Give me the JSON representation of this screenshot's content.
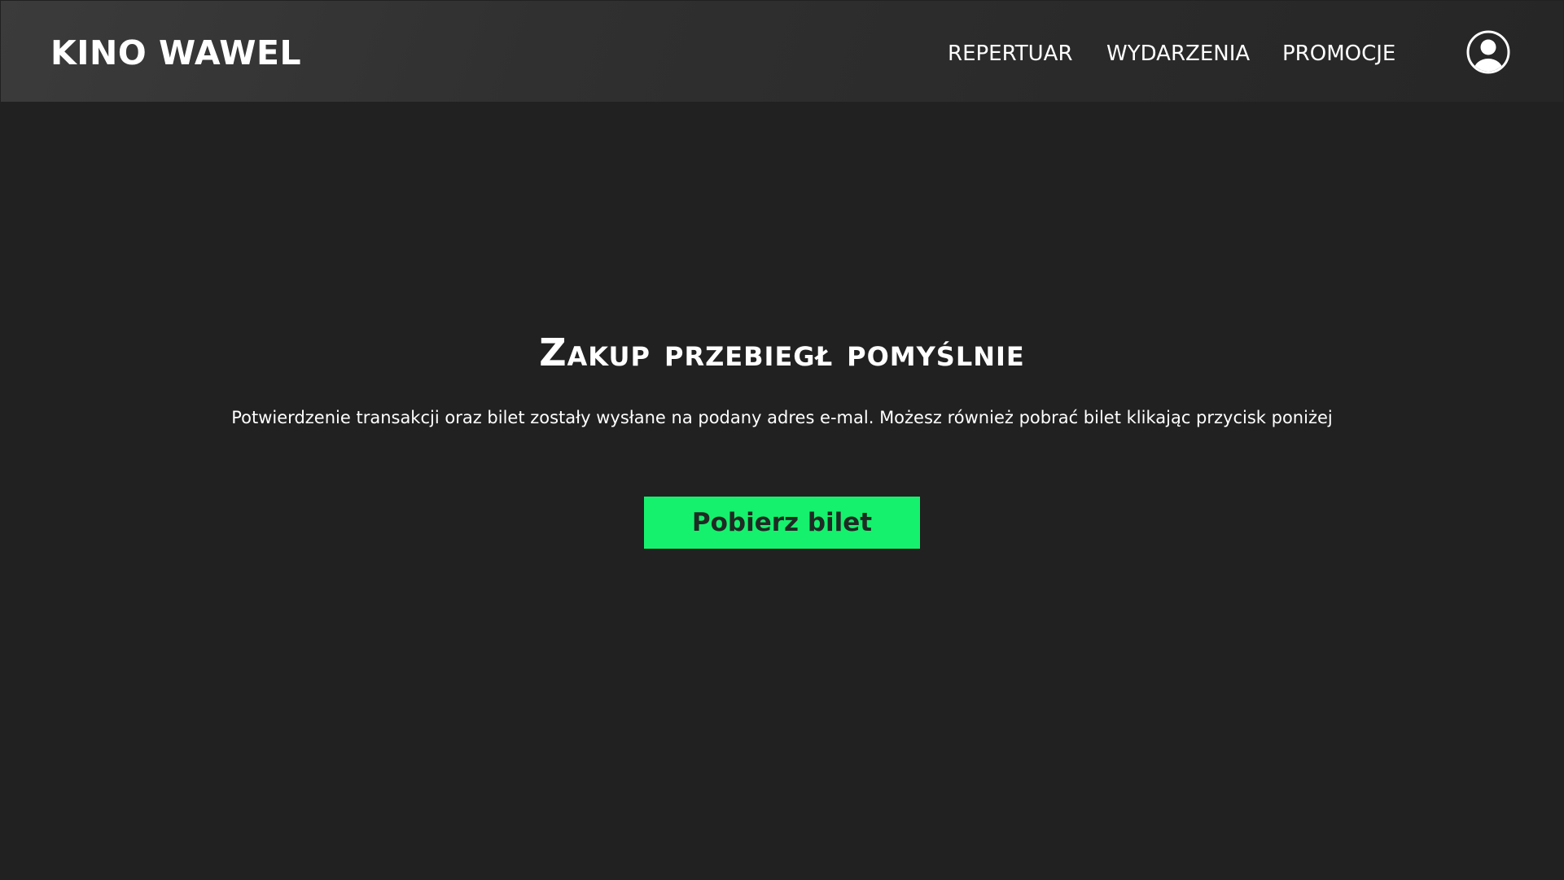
{
  "header": {
    "logo": "KINO WAWEL",
    "nav": {
      "repertuar": "REPERTUAR",
      "wydarzenia": "WYDARZENIA",
      "promocje": "PROMOCJE"
    },
    "user_icon": "user-circle-icon"
  },
  "main": {
    "title": "Zakup przebiegł pomyślnie",
    "message": "Potwierdzenie transakcji oraz bilet zostały wysłane na podany adres e-mal. Możesz również pobrać bilet klikając przycisk poniżej",
    "download_label": "Pobierz bilet"
  },
  "colors": {
    "background": "#212121",
    "header": "#333333",
    "accent": "#16f16d",
    "button_text": "#1f2a24",
    "text": "#ffffff"
  }
}
